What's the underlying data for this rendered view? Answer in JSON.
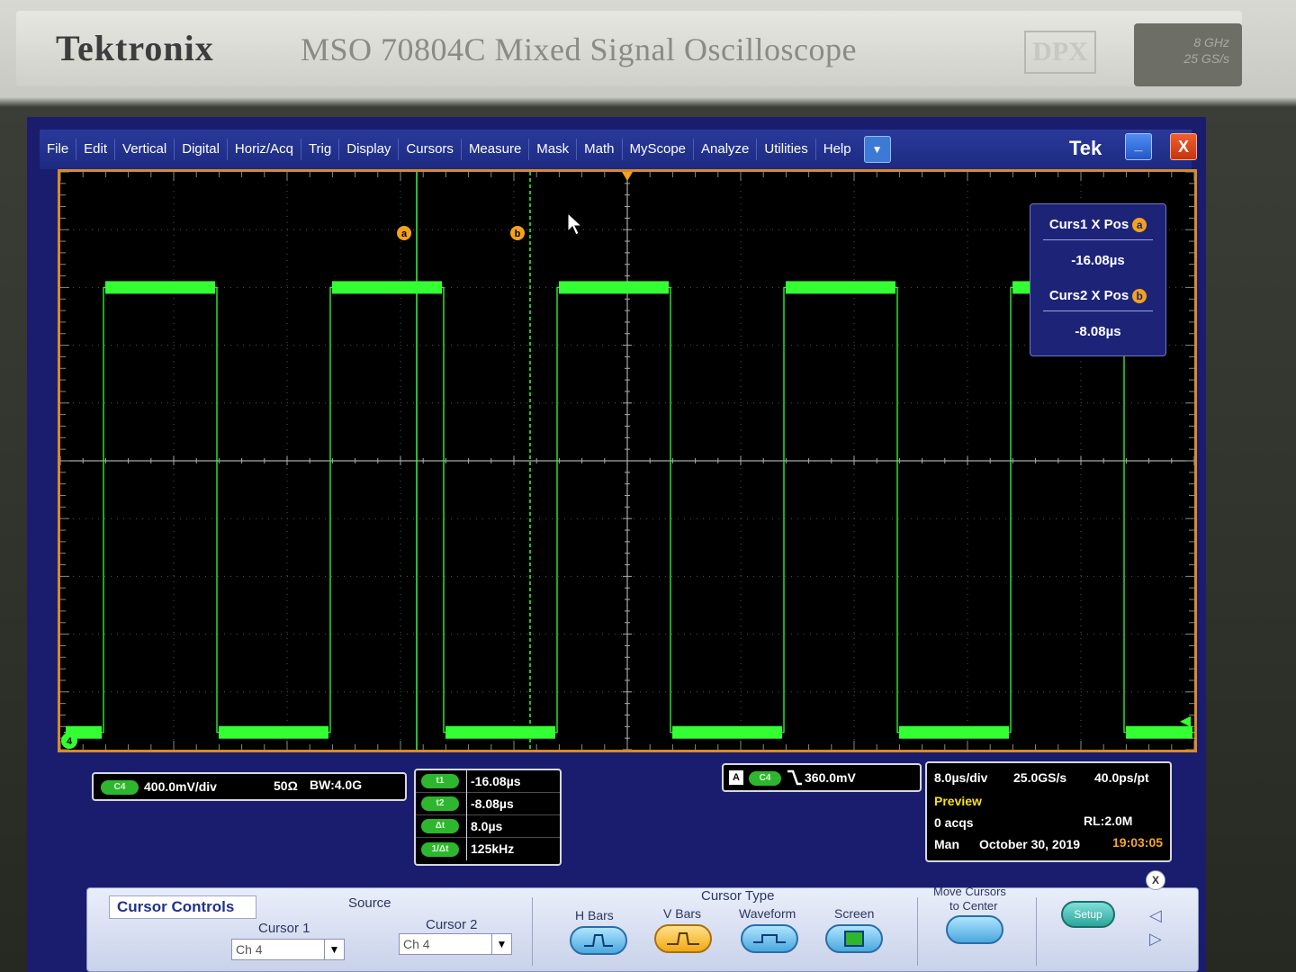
{
  "instrument": {
    "brand": "Tektronix",
    "model": "MSO 70804C Mixed Signal Oscilloscope",
    "badge": "DPX",
    "spec_lines": [
      "8 GHz",
      "25 GS/s"
    ]
  },
  "menu": {
    "items": [
      "File",
      "Edit",
      "Vertical",
      "Digital",
      "Horiz/Acq",
      "Trig",
      "Display",
      "Cursors",
      "Measure",
      "Mask",
      "Math",
      "MyScope",
      "Analyze",
      "Utilities",
      "Help"
    ],
    "dropdown_symbol": "▼",
    "tek_label": "Tek",
    "minimize_symbol": "_",
    "close_symbol": "X"
  },
  "waveform": {
    "channel": "4",
    "color": "#33ff33",
    "period_div": 2,
    "high_level_div": 3,
    "low_level_div": -4.7,
    "cursor_a_label": "a",
    "cursor_b_label": "b"
  },
  "cursor_readout": {
    "curs1_label": "Curs1 X Pos",
    "curs1_marker": "a",
    "curs1_value": "-16.08µs",
    "curs2_label": "Curs2 X Pos",
    "curs2_marker": "b",
    "curs2_value": "-8.08µs"
  },
  "channel_info": {
    "pill": "C4",
    "scale": "400.0mV/div",
    "impedance": "50Ω",
    "bandwidth": "BW:4.0G"
  },
  "cursor_values": [
    {
      "pill": "t1",
      "value": "-16.08µs"
    },
    {
      "pill": "t2",
      "value": "-8.08µs"
    },
    {
      "pill": "Δt",
      "value": "8.0µs"
    },
    {
      "pill": "1/Δt",
      "value": "125kHz"
    }
  ],
  "trigger": {
    "source_box": "A",
    "pill": "C4",
    "level": "360.0mV"
  },
  "acquisition": {
    "timebase": "8.0µs/div",
    "sample_rate": "25.0GS/s",
    "resolution": "40.0ps/pt",
    "mode": "Preview",
    "acqs": "0 acqs",
    "record_length": "RL:2.0M",
    "trigger_mode": "Man",
    "date": "October 30, 2019",
    "time": "19:03:05"
  },
  "cursor_controls": {
    "title": "Cursor Controls",
    "source_label": "Source",
    "cursor1_label": "Cursor 1",
    "cursor1_value": "Ch 4",
    "cursor2_label": "Cursor 2",
    "cursor2_value": "Ch 4",
    "cursor_type_label": "Cursor Type",
    "types": [
      "H Bars",
      "V Bars",
      "Waveform",
      "Screen"
    ],
    "active_type": "V Bars",
    "move_label_1": "Move Cursors",
    "move_label_2": "to Center",
    "setup_label": "Setup",
    "close_symbol": "X"
  }
}
